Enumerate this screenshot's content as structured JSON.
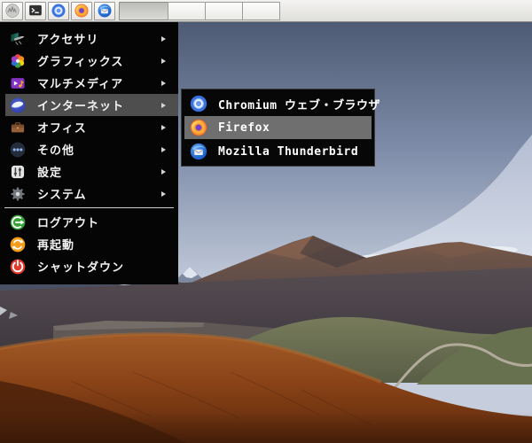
{
  "taskbar": {
    "launchers": [
      {
        "icon": "app-menu-icon"
      },
      {
        "icon": "terminal-icon"
      },
      {
        "icon": "chromium-icon"
      },
      {
        "icon": "firefox-icon"
      },
      {
        "icon": "thunderbird-icon"
      }
    ],
    "pager": {
      "desktop_count": 4,
      "active_desktop": 1
    }
  },
  "menu": {
    "categories": [
      {
        "label": "アクセサリ",
        "icon": "accessories-icon"
      },
      {
        "label": "グラフィックス",
        "icon": "graphics-icon"
      },
      {
        "label": "マルチメディア",
        "icon": "multimedia-icon"
      },
      {
        "label": "インターネット",
        "icon": "internet-icon",
        "highlighted": true
      },
      {
        "label": "オフィス",
        "icon": "office-icon"
      },
      {
        "label": "その他",
        "icon": "other-icon"
      },
      {
        "label": "設定",
        "icon": "settings-icon"
      },
      {
        "label": "システム",
        "icon": "system-icon"
      }
    ],
    "actions": [
      {
        "label": "ログアウト",
        "icon": "logout-icon"
      },
      {
        "label": "再起動",
        "icon": "restart-icon"
      },
      {
        "label": "シャットダウン",
        "icon": "shutdown-icon"
      }
    ]
  },
  "submenu": {
    "parent": "インターネット",
    "items": [
      {
        "label": "Chromium ウェブ・ブラウザ",
        "icon": "chromium-icon"
      },
      {
        "label": "Firefox",
        "icon": "firefox-icon",
        "highlighted": true
      },
      {
        "label": "Mozilla Thunderbird",
        "icon": "thunderbird-icon"
      }
    ]
  },
  "colors": {
    "menu_background": "#050505",
    "menu_highlight": "#4e4e4e",
    "submenu_highlight": "#6f6f6f",
    "menu_text": "#f2f2f2",
    "taskbar_background": "#eceae8",
    "wallpaper_sky_top": "#46526a",
    "wallpaper_sky_horizon": "#c6cedd",
    "wallpaper_foreground_hill": "#8a4317"
  }
}
